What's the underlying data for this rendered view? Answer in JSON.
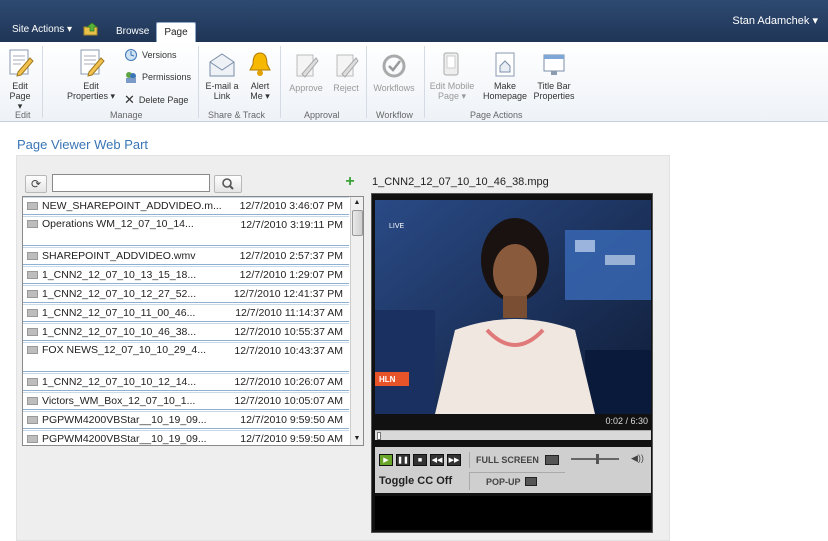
{
  "topbar": {
    "site_actions": "Site Actions ▾",
    "tabs": [
      {
        "label": "Browse"
      },
      {
        "label": "Page"
      }
    ],
    "user": "Stan Adamchek ▾"
  },
  "ribbon": {
    "groups": [
      {
        "label": "Edit"
      },
      {
        "label": "Manage"
      },
      {
        "label": "Share & Track"
      },
      {
        "label": "Approval"
      },
      {
        "label": "Workflow"
      },
      {
        "label": "Page Actions"
      }
    ],
    "buttons": {
      "edit_page": "Edit Page",
      "edit_properties": "Edit Properties ▾",
      "versions": "Versions",
      "permissions": "Permissions",
      "delete_page": "Delete Page",
      "email_link": "E-mail a Link",
      "alert_me": "Alert Me ▾",
      "approve": "Approve",
      "reject": "Reject",
      "workflows": "Workflows",
      "edit_mobile": "Edit Mobile Page ▾",
      "make_homepage": "Make Homepage",
      "title_bar": "Title Bar Properties"
    }
  },
  "webpart": {
    "title": "Page Viewer Web Part",
    "search": {
      "value": "",
      "placeholder": ""
    },
    "videos": [
      {
        "name": "NEW_SHAREPOINT_ADDVIDEO.m...",
        "date": "12/7/2010 3:46:07 PM",
        "lines": 1
      },
      {
        "name": "Operations WM_12_07_10_14...",
        "date": "12/7/2010 3:19:11 PM",
        "lines": 2
      },
      {
        "name": "SHAREPOINT_ADDVIDEO.wmv",
        "date": "12/7/2010 2:57:37 PM",
        "lines": 1
      },
      {
        "name": "1_CNN2_12_07_10_13_15_18...",
        "date": "12/7/2010 1:29:07 PM",
        "lines": 1
      },
      {
        "name": "1_CNN2_12_07_10_12_27_52...",
        "date": "12/7/2010 12:41:37 PM",
        "lines": 1
      },
      {
        "name": "1_CNN2_12_07_10_11_00_46...",
        "date": "12/7/2010 11:14:37 AM",
        "lines": 1
      },
      {
        "name": "1_CNN2_12_07_10_10_46_38...",
        "date": "12/7/2010 10:55:37 AM",
        "lines": 1
      },
      {
        "name": "FOX NEWS_12_07_10_10_29_4...",
        "date": "12/7/2010 10:43:37 AM",
        "lines": 2
      },
      {
        "name": "1_CNN2_12_07_10_10_12_14...",
        "date": "12/7/2010 10:26:07 AM",
        "lines": 1
      },
      {
        "name": "Victors_WM_Box_12_07_10_1...",
        "date": "12/7/2010 10:05:07 AM",
        "lines": 1
      },
      {
        "name": "PGPWM4200VBStar__10_19_09...",
        "date": "12/7/2010 9:59:50 AM",
        "lines": 1
      },
      {
        "name": "PGPWM4200VBStar__10_19_09...",
        "date": "12/7/2010 9:59:50 AM",
        "lines": 1
      }
    ],
    "player": {
      "title": "1_CNN2_12_07_10_10_46_38.mpg",
      "time": "0:02 / 6:30",
      "progress": 0.005,
      "volume": 0.55,
      "live_label": "LIVE",
      "hln_label": "HLN",
      "full_screen": "FULL SCREEN",
      "toggle_cc": "Toggle CC Off",
      "popup": "POP-UP"
    }
  }
}
